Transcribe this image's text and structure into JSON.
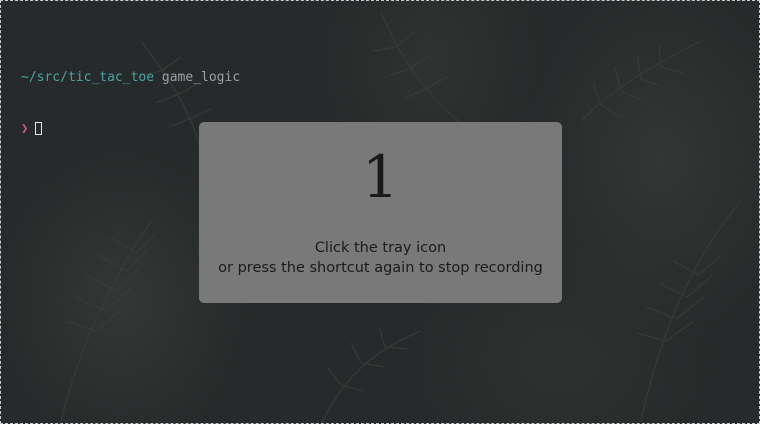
{
  "terminal": {
    "path": "~/src/tic_tac_toe",
    "branch": "game_logic",
    "prompt_symbol": "❯"
  },
  "recording_overlay": {
    "countdown": "1",
    "line1": "Click the tray icon",
    "line2": "or press the shortcut again to stop recording"
  },
  "colors": {
    "path": "#4aa3a5",
    "branch": "#9aa0a0",
    "prompt_symbol": "#d4568f",
    "overlay_bg": "#808080",
    "desktop_bg": "#272a2a"
  }
}
